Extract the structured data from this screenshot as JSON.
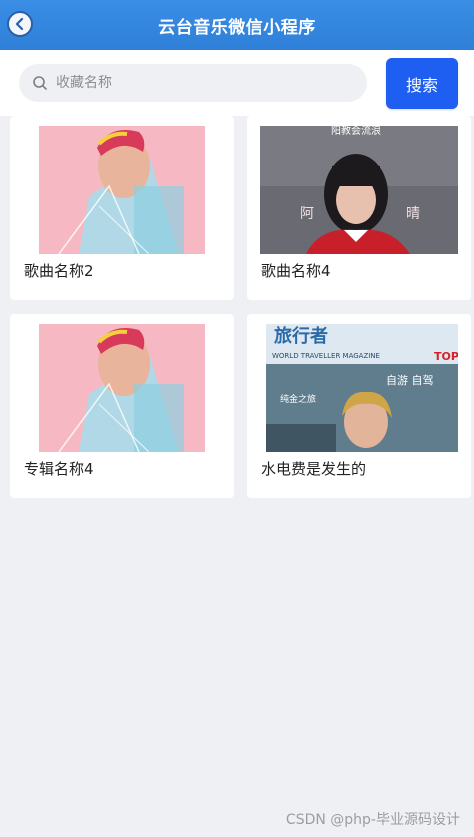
{
  "navbar": {
    "title": "云台音乐微信小程序",
    "back_icon": "chevron-left-icon"
  },
  "search": {
    "placeholder": "收藏名称",
    "value": "",
    "button_label": "搜索",
    "icon": "search-icon"
  },
  "items": [
    {
      "title": "歌曲名称2",
      "cover_art": "pink-portrait"
    },
    {
      "title": "歌曲名称4",
      "cover_art": "poster-girl",
      "cover_text": [
        "阳教会流浪",
        "阿",
        "晴"
      ]
    },
    {
      "title": "专辑名称4",
      "cover_art": "pink-portrait"
    },
    {
      "title": "水电费是发生的",
      "cover_art": "magazine",
      "cover_text": [
        "旅行者",
        "WORLD TRAVELLER MAGAZINE",
        "TOP",
        "自游 自驾",
        "纯金之旅"
      ]
    }
  ],
  "footer": {
    "credit": "CSDN @php-毕业源码设计"
  },
  "colors": {
    "navbar": "#2e7fd8",
    "search_button": "#1e5ef0",
    "background": "#eef0f3"
  }
}
